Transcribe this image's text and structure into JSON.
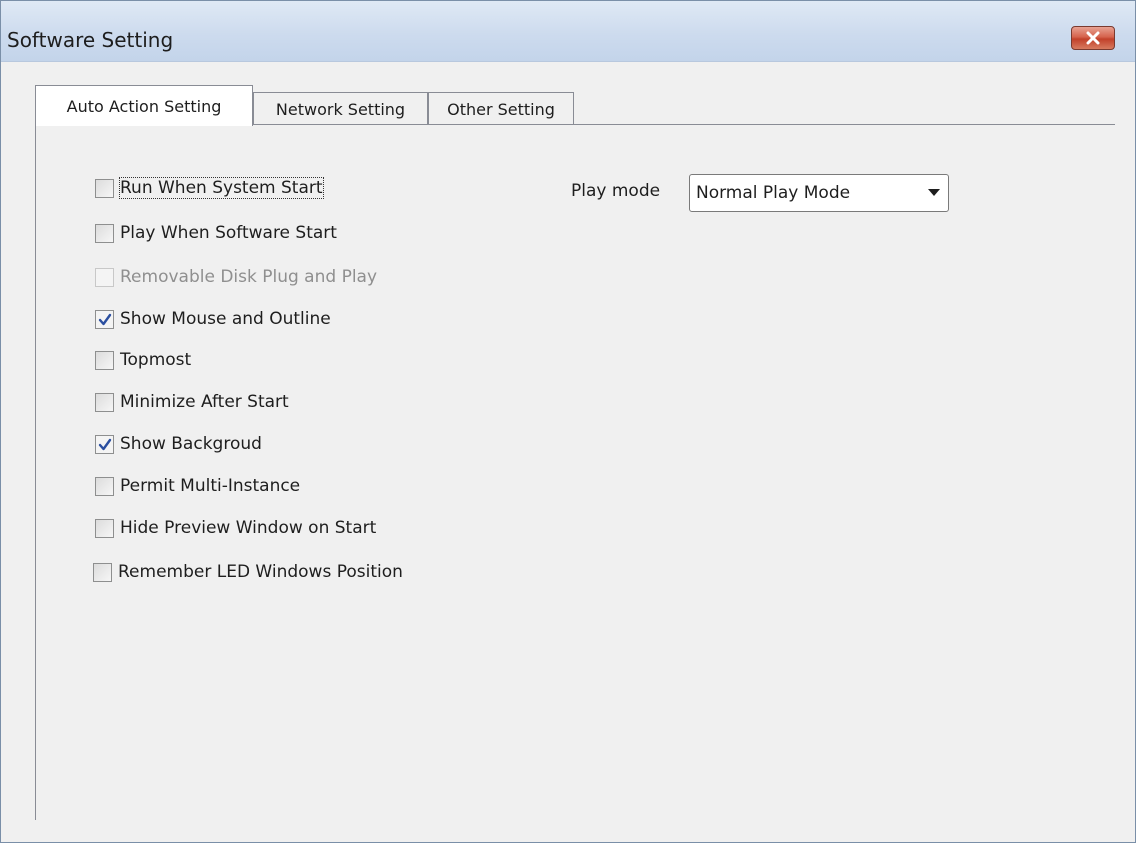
{
  "window": {
    "title": "Software Setting"
  },
  "tabs": [
    {
      "label": "Auto Action Setting",
      "active": true
    },
    {
      "label": "Network Setting",
      "active": false
    },
    {
      "label": "Other Setting",
      "active": false
    }
  ],
  "options": [
    {
      "label": "Run When System Start",
      "checked": false,
      "disabled": false
    },
    {
      "label": "Play When Software Start",
      "checked": false,
      "disabled": false
    },
    {
      "label": "Removable Disk Plug and Play",
      "checked": false,
      "disabled": true
    },
    {
      "label": "Show Mouse and Outline",
      "checked": true,
      "disabled": false
    },
    {
      "label": "Topmost",
      "checked": false,
      "disabled": false
    },
    {
      "label": "Minimize After Start",
      "checked": false,
      "disabled": false
    },
    {
      "label": "Show Backgroud",
      "checked": true,
      "disabled": false
    },
    {
      "label": "Permit Multi-Instance",
      "checked": false,
      "disabled": false
    },
    {
      "label": "Hide Preview Window on Start",
      "checked": false,
      "disabled": false
    },
    {
      "label": "Remember LED Windows Position",
      "checked": false,
      "disabled": false
    }
  ],
  "play_mode": {
    "label": "Play mode",
    "selected": "Normal Play Mode"
  },
  "icons": {
    "close": "close-icon",
    "dropdown": "chevron-down-icon",
    "check": "check-icon"
  },
  "colors": {
    "close_button": "#c2412a",
    "checkmark": "#2b4fa0"
  }
}
